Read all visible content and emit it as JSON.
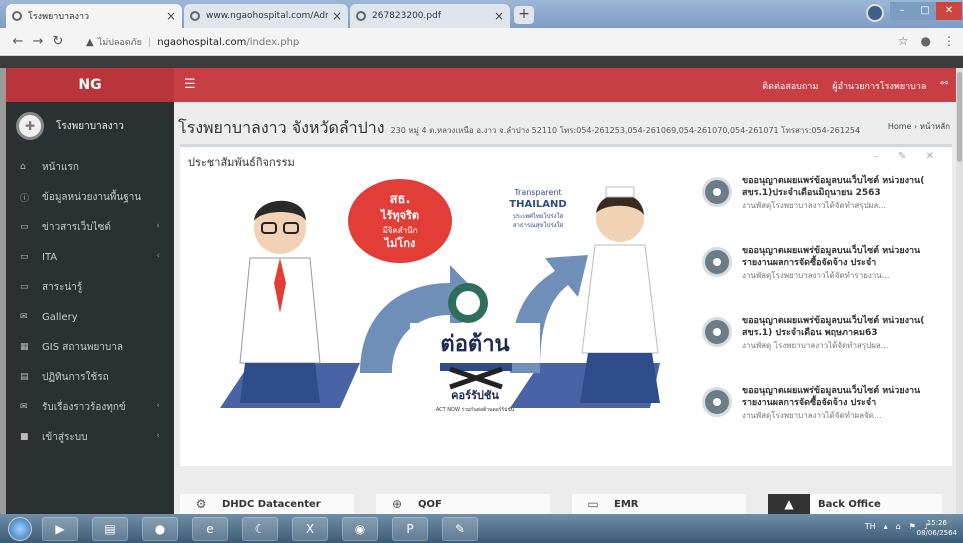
{
  "browser": {
    "tabs": [
      {
        "title": "โรงพยาบาลงาว",
        "active": true
      },
      {
        "title": "www.ngaohospital.com/Admin/",
        "active": false
      },
      {
        "title": "267823200.pdf",
        "active": false
      }
    ],
    "new_tab": "+",
    "address": {
      "insecure_label": "ไม่ปลอดภัย",
      "domain": "ngaohospital.com",
      "path": "/index.php"
    }
  },
  "topnav": {
    "brand": "NG",
    "menu_icon": "☰",
    "links": [
      "ติดต่อสอบถาม",
      "ผู้อำนวยการโรงพยาบาล"
    ]
  },
  "sidebar": {
    "user_name": "โรงพยาบาลงาว",
    "items": [
      {
        "label": "หน้าแรก",
        "icon": "home-icon",
        "has_caret": false
      },
      {
        "label": "ข้อมูลหน่วยงานพื้นฐาน",
        "icon": "info-icon",
        "has_caret": false
      },
      {
        "label": "ข่าวสารเว็บไซต์",
        "icon": "laptop-icon",
        "has_caret": true
      },
      {
        "label": "ITA",
        "icon": "laptop-icon",
        "has_caret": true
      },
      {
        "label": "สาระน่ารู้",
        "icon": "laptop-icon",
        "has_caret": false
      },
      {
        "label": "Gallery",
        "icon": "envelope-icon",
        "has_caret": false
      },
      {
        "label": "GIS สถานพยาบาล",
        "icon": "grid-icon",
        "has_caret": false
      },
      {
        "label": "ปฏิทินการใช้รถ",
        "icon": "calendar-icon",
        "has_caret": false
      },
      {
        "label": "รับเรื่องราวร้องทุกข์",
        "icon": "envelope-icon",
        "has_caret": true
      },
      {
        "label": "เข้าสู่ระบบ",
        "icon": "folder-icon",
        "has_caret": true
      }
    ]
  },
  "content": {
    "title": "โรงพยาบาลงาว จังหวัดลำปาง",
    "subtitle": "230 หมู่ 4 ต.หลวงเหนือ อ.งาว จ.ลำปาง 52110 โทร:054-261253,054-261069,054-261070,054-261071 โทรสาร:054-261254",
    "breadcrumb": "Home  ›  หน้าหลัก",
    "box_title": "ประชาสัมพันธ์กิจกรรม",
    "box_tools": "– ✎ ✕",
    "poster": {
      "bubble_line1": "สธ.",
      "bubble_line2": "ไร้ทุจริต",
      "bubble_line3": "มีจิตสำนึก",
      "bubble_line4": "ไม่โกง",
      "tt_line1": "Transparent",
      "tt_line2": "THAILAND",
      "tt_line3": "ประเทศไทยโปร่งใส",
      "tt_line4": "สาธารณสุขโปร่งใส",
      "banner_line1": "ต่อต้าน",
      "banner_line2": "คอร์รัปชัน",
      "banner_line3": "ACT NOW ร่วมกันต่อต้านคอร์รัปชัน"
    },
    "news": [
      {
        "title": "ขออนุญาตเผยแพร่ข้อมูลบนเว็บไซต์ หน่วยงาน( สขร.1)ประจำเดือนมิถุนายน 2563",
        "desc": "งานพัสดุโรงพยาบาลงาวได้จัดทำสรุปผล..."
      },
      {
        "title": "ขออนุญาตเผยแพร่ข้อมูลบนเว็บไซต์ หน่วยงานรายงานผลการจัดซื้อจัดจ้าง ประจำ",
        "desc": "งานพัสดุโรงพยาบาลงาวได้จัดทำรายงาน..."
      },
      {
        "title": "ขออนุญาตเผยแพร่ข้อมูลบนเว็บไซต์ หน่วยงาน( สขร.1) ประจำเดือน พฤษภาคม63",
        "desc": "งานพัสดุ โรงพยาบาลงาวได้จัดทำสรุปผล..."
      },
      {
        "title": "ขออนุญาตเผยแพร่ข้อมูลบนเว็บไซต์ หน่วยงานรายงานผลการจัดซื้อจัดจ้าง ประจำ",
        "desc": "งานพัสดุโรงพยาบาลงาวได้จัดทำผลจัด..."
      }
    ],
    "tiles": [
      {
        "label": "DHDC Datacenter",
        "icon": "chart-icon"
      },
      {
        "label": "QOF",
        "icon": "search-plus-icon"
      },
      {
        "label": "EMR",
        "icon": "monitor-icon"
      },
      {
        "label": "Back Office",
        "icon": "arrow-up-icon"
      }
    ]
  },
  "taskbar": {
    "tray_lang": "TH",
    "time": "15:26",
    "date": "08/06/2564"
  }
}
